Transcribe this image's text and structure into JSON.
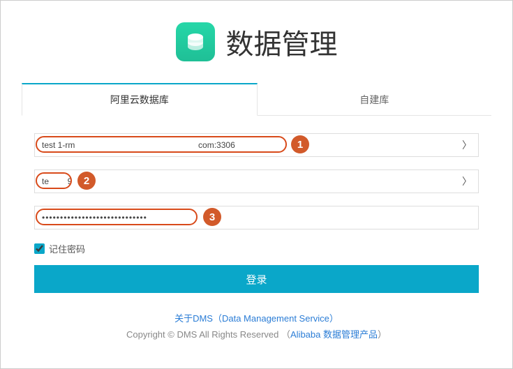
{
  "header": {
    "title": "数据管理",
    "logo_name": "database-icon"
  },
  "tabs": {
    "active": "阿里云数据库",
    "inactive": "自建库"
  },
  "form": {
    "host": {
      "value": "test 1-rm                                                     com:3306"
    },
    "user": {
      "value": "te        9"
    },
    "password": {
      "value": "•••••••••••••••••••••••••••••"
    },
    "remember": {
      "label": "记住密码",
      "checked": true
    },
    "login_label": "登录"
  },
  "annotations": {
    "b1": "1",
    "b2": "2",
    "b3": "3"
  },
  "footer": {
    "about": "关于DMS（Data Management Service）",
    "copyright_pre": "Copyright © DMS All Rights Reserved （",
    "copyright_link": "Alibaba 数据管理产品",
    "copyright_post": "）"
  }
}
